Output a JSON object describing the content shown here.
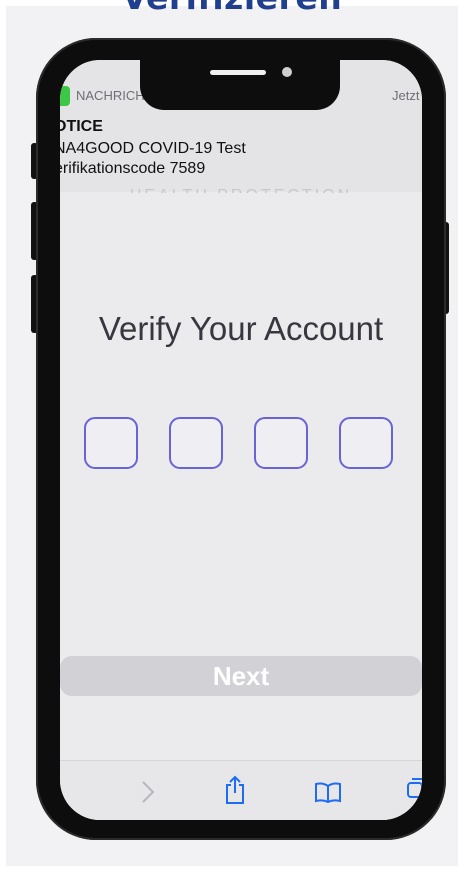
{
  "page": {
    "title": "Verifizieren"
  },
  "notification": {
    "app": "NACHRICHTEN",
    "time": "Jetzt",
    "title": "OTICE",
    "lines": [
      "NA4GOOD  COVID-19 Test",
      "erifikationscode 7589"
    ]
  },
  "app": {
    "ghost_header": "HEALTH PROTECTION",
    "heading": "Verify Your Account",
    "code_digits": [
      "",
      "",
      "",
      ""
    ],
    "next_label": "Next"
  },
  "toolbar": {
    "items": [
      "back-icon",
      "forward-icon",
      "share-icon",
      "bookmarks-icon",
      "tabs-icon"
    ]
  },
  "colors": {
    "title": "#213f8f",
    "code_border": "#6a63d6",
    "next_bg": "#d1d1d6",
    "accent": "#1d6cf2"
  }
}
